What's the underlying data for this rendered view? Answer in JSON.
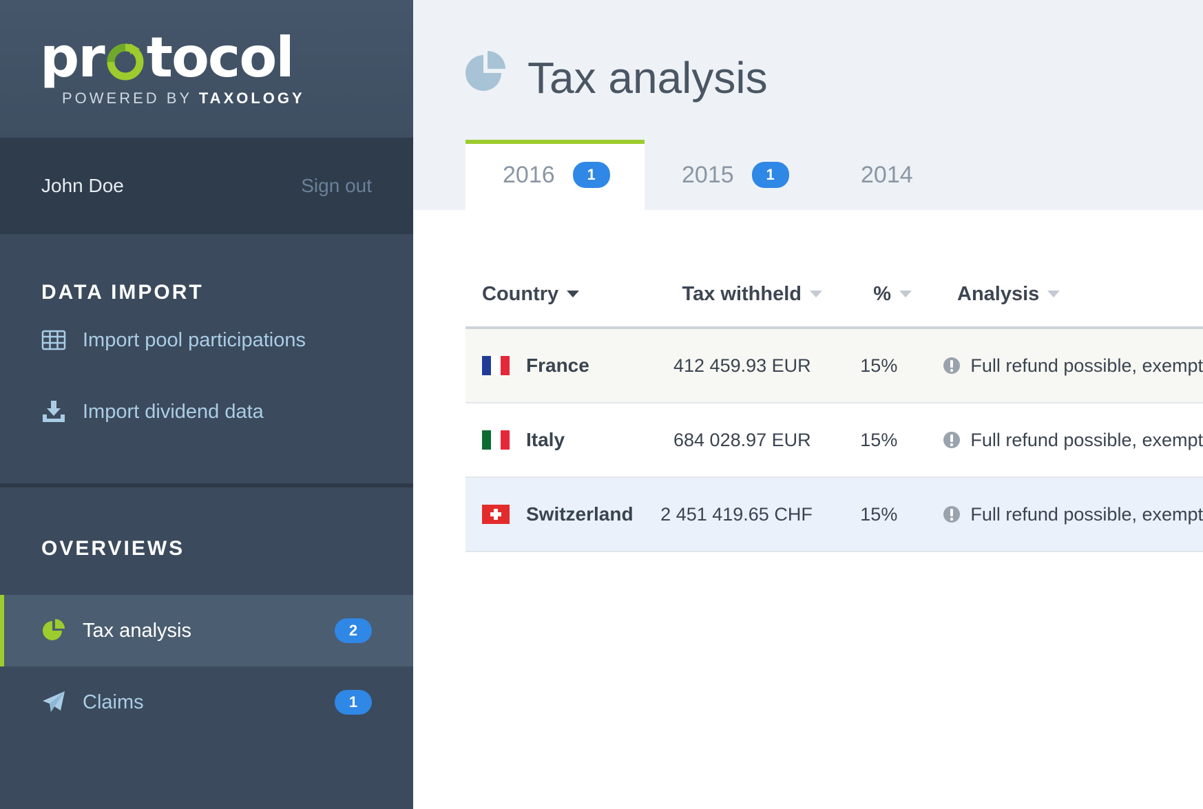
{
  "brand": {
    "logo_text": "protocol",
    "powered_by": "POWERED BY",
    "powered_company": "TAXOLOGY"
  },
  "user": {
    "name": "John Doe",
    "signout_label": "Sign out"
  },
  "sidebar": {
    "sections": [
      {
        "title": "DATA IMPORT",
        "items": [
          {
            "label": "Import pool participations",
            "icon": "table-grid-icon"
          },
          {
            "label": "Import dividend data",
            "icon": "download-tray-icon"
          }
        ]
      },
      {
        "title": "OVERVIEWS",
        "items": [
          {
            "label": "Tax analysis",
            "icon": "pie-chart-icon",
            "badge": "2",
            "active": true
          },
          {
            "label": "Claims",
            "icon": "paper-plane-icon",
            "badge": "1"
          }
        ]
      }
    ]
  },
  "page": {
    "title": "Tax analysis",
    "icon": "pie-chart-icon"
  },
  "tabs": [
    {
      "label": "2016",
      "badge": "1",
      "active": true
    },
    {
      "label": "2015",
      "badge": "1"
    },
    {
      "label": "2014"
    }
  ],
  "table": {
    "columns": [
      "Country",
      "Tax withheld",
      "%",
      "Analysis"
    ],
    "rows": [
      {
        "country": "France",
        "tax": "412 459.93 EUR",
        "pct": "15%",
        "analysis": "Full refund possible, exempt"
      },
      {
        "country": "Italy",
        "tax": "684 028.97 EUR",
        "pct": "15%",
        "analysis": "Full refund possible, exempt"
      },
      {
        "country": "Switzerland",
        "tax": "2 451 419.65 CHF",
        "pct": "15%",
        "analysis": "Full refund possible, exempt"
      }
    ]
  },
  "colors": {
    "sidebar_bg": "#3b4a5c",
    "accent_green": "#9ccc2e",
    "badge_blue": "#2f87e6",
    "header_bg": "#eef2f6"
  }
}
